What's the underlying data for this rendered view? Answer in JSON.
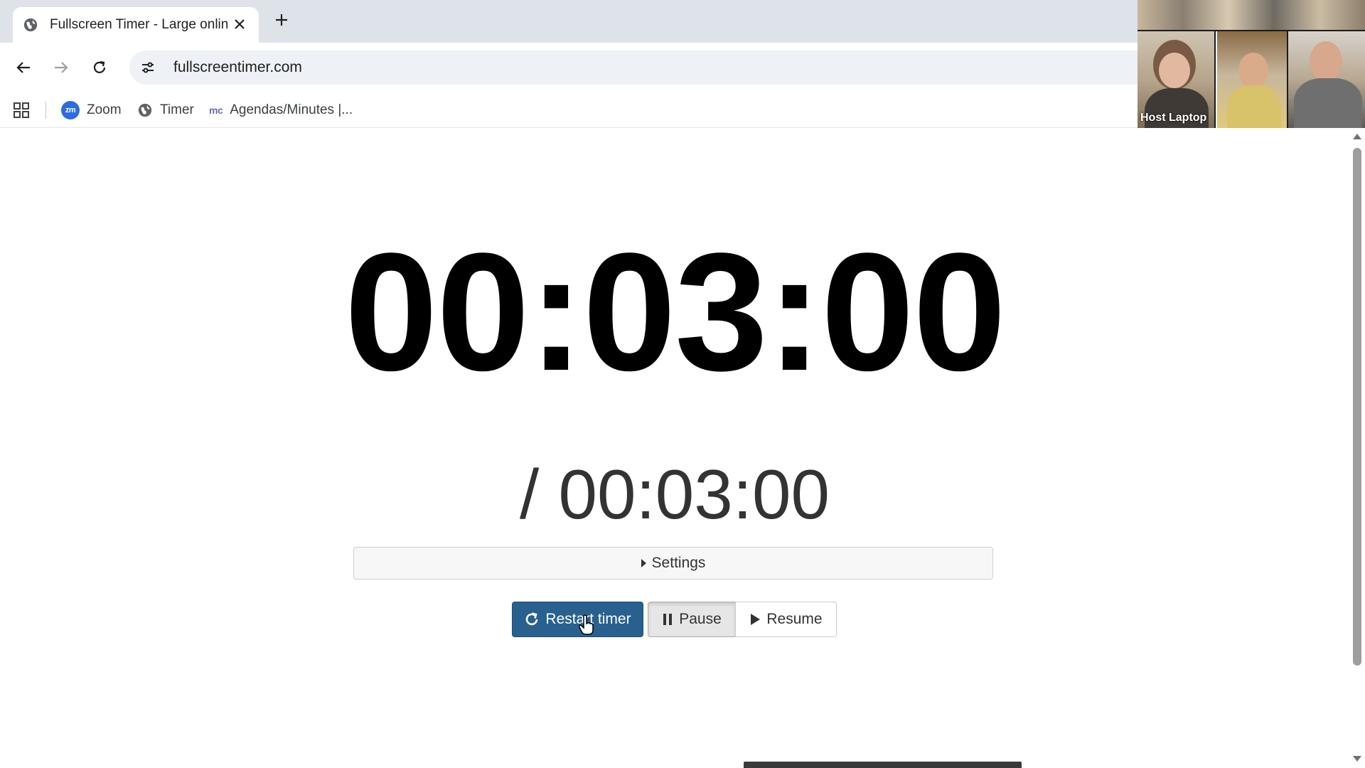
{
  "browser": {
    "tab": {
      "title": "Fullscreen Timer - Large online",
      "favicon": "globe-icon"
    },
    "address": {
      "url": "fullscreentimer.com"
    },
    "bookmarks": [
      {
        "label": "Zoom",
        "icon": "zoom-icon",
        "badge": "zm"
      },
      {
        "label": "Timer",
        "icon": "globe-icon"
      },
      {
        "label": "Agendas/Minutes |...",
        "icon": "mc-icon",
        "badge": "mc"
      }
    ]
  },
  "video_panel": {
    "tiles": [
      {
        "label": "Host Laptop"
      }
    ]
  },
  "timer": {
    "current": "00:03:00",
    "total": "/ 00:03:00"
  },
  "settings": {
    "label": "Settings"
  },
  "controls": {
    "restart_label": "Restart timer",
    "pause_label": "Pause",
    "resume_label": "Resume"
  },
  "colors": {
    "primary_button": "#286090",
    "tabstrip": "#dee3ea",
    "omnibox": "#eef1f5"
  }
}
